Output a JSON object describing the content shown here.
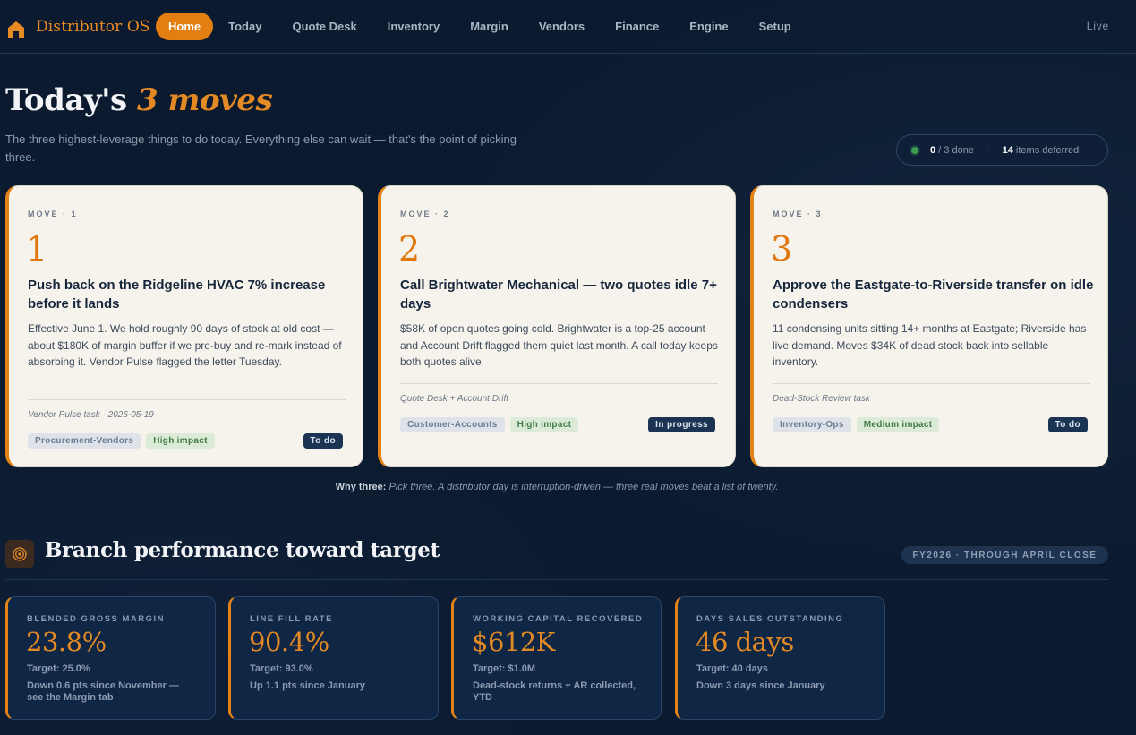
{
  "brand": {
    "name": "Distributor OS"
  },
  "nav": {
    "items": [
      "Home",
      "Today",
      "Quote Desk",
      "Inventory",
      "Margin",
      "Vendors",
      "Finance",
      "Engine",
      "Setup"
    ],
    "active": "Home",
    "live": "Live"
  },
  "hero": {
    "title_prefix": "Today's",
    "title_accent": "3 moves",
    "subtitle": "The three highest-leverage things to do today. Everything else can wait — that's the point of picking three."
  },
  "progress": {
    "done": "0",
    "total_suffix": " / 3 done",
    "deferred_count": "14",
    "deferred_suffix": " items deferred",
    "separator": "·"
  },
  "moves": [
    {
      "label": "MOVE · 1",
      "number": "1",
      "title": "Push back on the Ridgeline HVAC 7% increase before it lands",
      "body": "Effective June 1. We hold roughly 90 days of stock at old cost — about $180K of margin buffer if we pre-buy and re-mark instead of absorbing it. Vendor Pulse flagged the letter Tuesday.",
      "source": "Vendor Pulse task · 2026-05-19",
      "area": "Procurement-Vendors",
      "impact": "High impact",
      "status": "To do"
    },
    {
      "label": "MOVE · 2",
      "number": "2",
      "title": "Call Brightwater Mechanical — two quotes idle 7+ days",
      "body": "$58K of open quotes going cold. Brightwater is a top-25 account and Account Drift flagged them quiet last month. A call today keeps both quotes alive.",
      "source": "Quote Desk + Account Drift",
      "area": "Customer-Accounts",
      "impact": "High impact",
      "status": "In progress"
    },
    {
      "label": "MOVE · 3",
      "number": "3",
      "title": "Approve the Eastgate-to-Riverside transfer on idle condensers",
      "body": "11 condensing units sitting 14+ months at Eastgate; Riverside has live demand. Moves $34K of dead stock back into sellable inventory.",
      "source": "Dead-Stock Review task",
      "area": "Inventory-Ops",
      "impact": "Medium impact",
      "status": "To do"
    }
  ],
  "why": {
    "label": "Why three:",
    "text": "Pick three. A distributor day is interruption-driven — three real moves beat a list of twenty."
  },
  "performance": {
    "title": "Branch performance toward target",
    "period": "FY2026 · THROUGH APRIL CLOSE",
    "kpis": [
      {
        "label": "BLENDED GROSS MARGIN",
        "value": "23.8%",
        "target": "Target: 25.0%",
        "note": "Down 0.6 pts since November — see the Margin tab"
      },
      {
        "label": "LINE FILL RATE",
        "value": "90.4%",
        "target": "Target: 93.0%",
        "note": "Up 1.1 pts since January"
      },
      {
        "label": "WORKING CAPITAL RECOVERED",
        "value": "$612K",
        "target": "Target: $1.0M",
        "note": "Dead-stock returns + AR collected, YTD"
      },
      {
        "label": "DAYS SALES OUTSTANDING",
        "value": "46 days",
        "target": "Target: 40 days",
        "note": "Down 3 days since January"
      }
    ]
  },
  "colors": {
    "accent": "#e37e10",
    "background": "#0b1a2e",
    "card": "#f6f3ec"
  }
}
